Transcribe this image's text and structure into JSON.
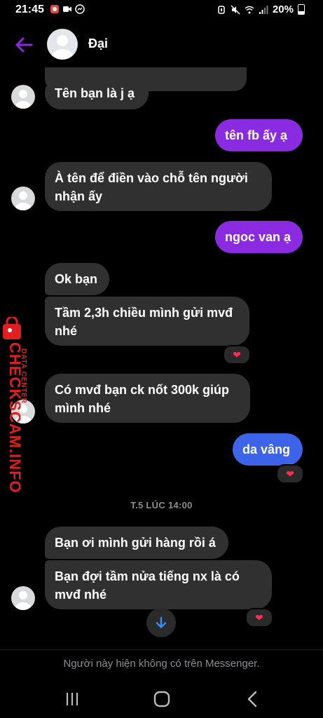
{
  "status_bar": {
    "time": "21:45",
    "battery": "20%",
    "left_icons": [
      "notification-icon",
      "video-icon",
      "messenger-icon"
    ],
    "right_icons": [
      "alarm-icon",
      "mute-icon",
      "wifi-icon",
      "signal-icon",
      "battery-icon"
    ]
  },
  "header": {
    "contact_name": "Đại",
    "back_icon": "arrow-left-icon",
    "accent_color": "#8a2be2"
  },
  "messages": [
    {
      "from": "them",
      "text": "Tên bạn là j ạ"
    },
    {
      "from": "me",
      "text": "tên fb ấy ạ"
    },
    {
      "from": "them",
      "text": "À tên để điền vào chỗ tên người nhận ấy"
    },
    {
      "from": "me",
      "text": "ngoc van ạ"
    },
    {
      "from": "them",
      "text": "Ok bạn"
    },
    {
      "from": "them",
      "text": "Tầm 2,3h chiều mình gửi mvđ nhé",
      "reaction": "❤"
    },
    {
      "from": "them",
      "text": "Có mvđ bạn ck nốt 300k giúp mình nhé"
    },
    {
      "from": "me",
      "text": "da vâng",
      "reaction": "❤"
    },
    {
      "from": "them",
      "text": "Bạn ơi mình gửi hàng rồi á"
    },
    {
      "from": "them",
      "text": "Bạn đợi tầm nửa tiếng nx là có mvđ nhé",
      "reaction": "❤"
    }
  ],
  "time_divider": "T.5 LÚC 14:00",
  "watermark": {
    "main": "CHECKSCAM.INFO",
    "sub": "DATA CENTER"
  },
  "footer": {
    "notice": "Người này hiện không có trên Messenger."
  },
  "nav_bar": {
    "buttons": [
      "recent-apps-icon",
      "home-icon",
      "back-icon"
    ]
  },
  "colors": {
    "background": "#000000",
    "received_bubble": "#303030",
    "sent_bubble_purple": "#8a2be2",
    "sent_bubble_blue": "#3d63e8",
    "heart": "#ff2d55",
    "watermark_red": "#e02020"
  }
}
